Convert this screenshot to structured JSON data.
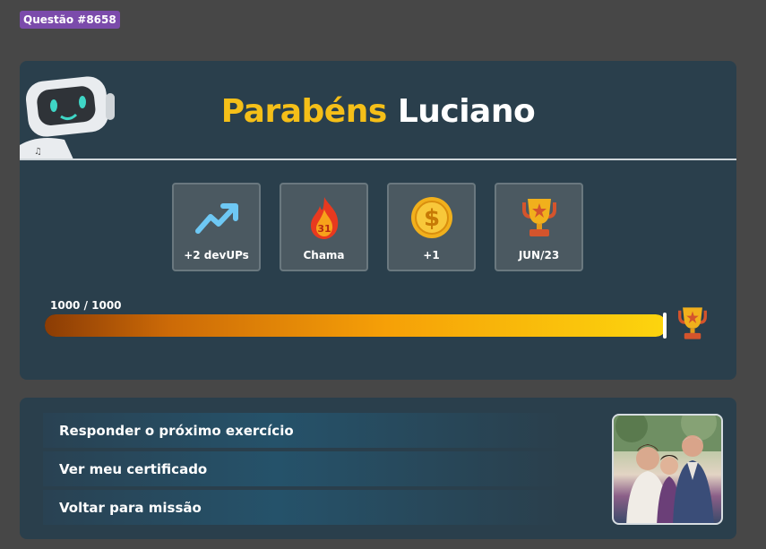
{
  "header": {
    "question_badge": "Questão #8658"
  },
  "congrats": {
    "word": "Parabéns",
    "name": "Luciano"
  },
  "stats": [
    {
      "icon": "trending-up-icon",
      "label": "+2 devUPs"
    },
    {
      "icon": "flame-icon",
      "label": "Chama",
      "flame_number": "31"
    },
    {
      "icon": "coin-icon",
      "label": "+1"
    },
    {
      "icon": "trophy-icon",
      "label": "JUN/23"
    }
  ],
  "progress": {
    "text": "1000 / 1000",
    "fraction": 1.0
  },
  "actions": [
    {
      "label": "Responder o próximo exercício"
    },
    {
      "label": "Ver meu certificado"
    },
    {
      "label": "Voltar para missão"
    }
  ],
  "colors": {
    "accent": "#f5bf18",
    "card_bg": "#2a3f4c",
    "page_bg": "#474747",
    "badge_bg": "#7b4bab"
  }
}
